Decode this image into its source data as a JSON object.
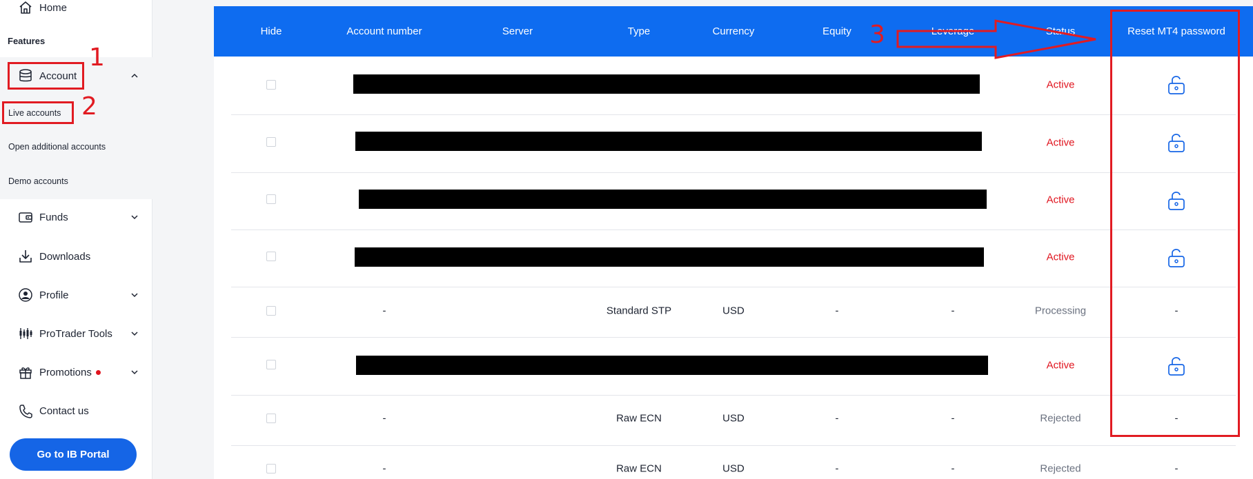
{
  "sidebar": {
    "home_label": "Home",
    "features_label": "Features",
    "account_label": "Account",
    "sub_items": [
      "Live accounts",
      "Open additional accounts",
      "Demo accounts"
    ],
    "funds_label": "Funds",
    "downloads_label": "Downloads",
    "profile_label": "Profile",
    "protrader_label": "ProTrader Tools",
    "promotions_label": "Promotions",
    "contact_label": "Contact us",
    "ib_button": "Go to IB Portal"
  },
  "annotations": {
    "n1": "1",
    "n2": "2",
    "n3": "3",
    "color": "#e11b22"
  },
  "table": {
    "columns": [
      "Hide",
      "Account number",
      "Server",
      "Type",
      "Currency",
      "Equity",
      "Leverage",
      "Status",
      "Reset MT4 password"
    ],
    "rows": [
      {
        "redacted": true,
        "status": "Active",
        "reset": "lock-icon"
      },
      {
        "redacted": true,
        "status": "Active",
        "reset": "lock-icon"
      },
      {
        "redacted": true,
        "status": "Active",
        "reset": "lock-icon"
      },
      {
        "redacted": true,
        "status": "Active",
        "reset": "lock-icon"
      },
      {
        "redacted": false,
        "account": "-",
        "type": "Standard STP",
        "currency": "USD",
        "equity": "-",
        "leverage": "-",
        "status": "Processing",
        "reset": "-"
      },
      {
        "redacted": true,
        "status": "Active",
        "reset": "lock-icon"
      },
      {
        "redacted": false,
        "account": "-",
        "type": "Raw ECN",
        "currency": "USD",
        "equity": "-",
        "leverage": "-",
        "status": "Rejected",
        "reset": "-"
      },
      {
        "redacted": false,
        "account": "-",
        "type": "Raw ECN",
        "currency": "USD",
        "equity": "-",
        "leverage": "-",
        "status": "Rejected",
        "reset": "-"
      }
    ]
  },
  "colors": {
    "header_blue": "#0e6cf0",
    "button_blue": "#1565e6",
    "active_red": "#e0141e",
    "muted_gray": "#6b7280"
  }
}
